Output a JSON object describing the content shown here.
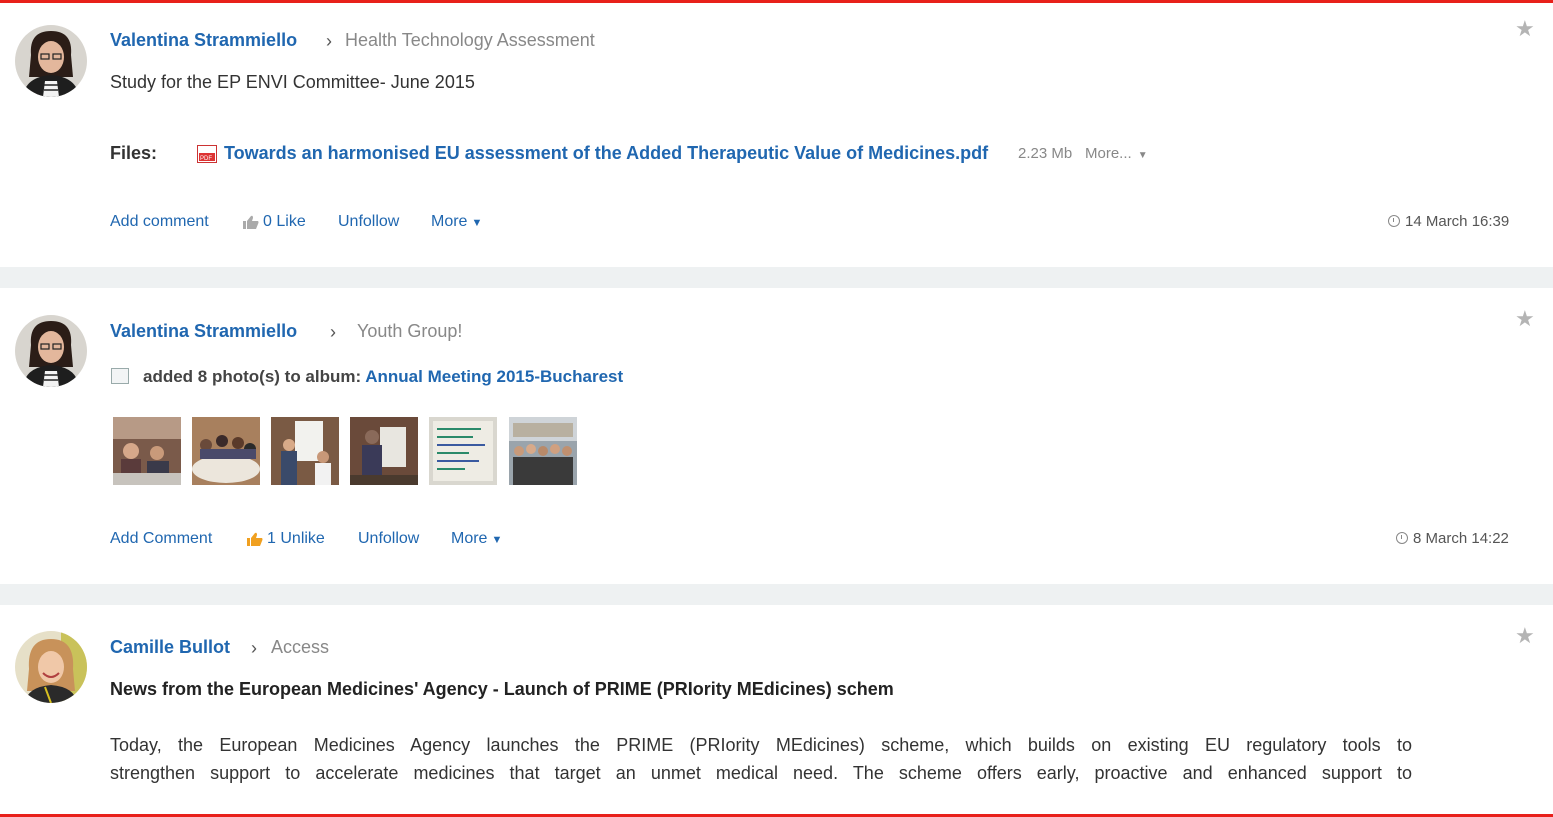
{
  "posts": [
    {
      "author": "Valentina Strammiello",
      "group": "Health Technology Assessment",
      "text": "Study for the EP ENVI Committee- June 2015",
      "files_label": "Files:",
      "file_name": "Towards an harmonised EU assessment of the Added Therapeutic Value of Medicines.pdf",
      "file_size": "2.23 Mb",
      "file_more": "More...",
      "actions": {
        "comment": "Add comment",
        "like_count": "0",
        "like": "Like",
        "follow": "Unfollow",
        "more": "More"
      },
      "time": "14 March 16:39"
    },
    {
      "author": "Valentina Strammiello",
      "group": "Youth Group!",
      "album_prefix": "added 8 photo(s) to album:",
      "album_name": "Annual Meeting 2015-Bucharest",
      "actions": {
        "comment": "Add Comment",
        "like_count": "1",
        "like": "Unlike",
        "follow": "Unfollow",
        "more": "More"
      },
      "time": "8 March 14:22"
    },
    {
      "author": "Camille Bullot",
      "group": "Access",
      "title": "News from the European Medicines' Agency - Launch of PRIME (PRIority MEdicines) schem",
      "body_line1": "Today, the European Medicines Agency launches the PRIME (PRIority MEdicines) scheme, which builds on existing EU regulatory tools to",
      "body_line2": "strengthen support to accelerate medicines that target an unmet medical need. The scheme offers early, proactive and enhanced support to"
    }
  ],
  "colors": {
    "link": "#2067b0",
    "accent_bar": "#e8201a",
    "separator": "#eef1f2",
    "like_active": "#f0a020"
  },
  "icons": [
    "star-icon",
    "chevron-right-icon",
    "pdf-icon",
    "thumbs-up-icon",
    "clock-icon",
    "album-icon",
    "caret-down-icon"
  ]
}
